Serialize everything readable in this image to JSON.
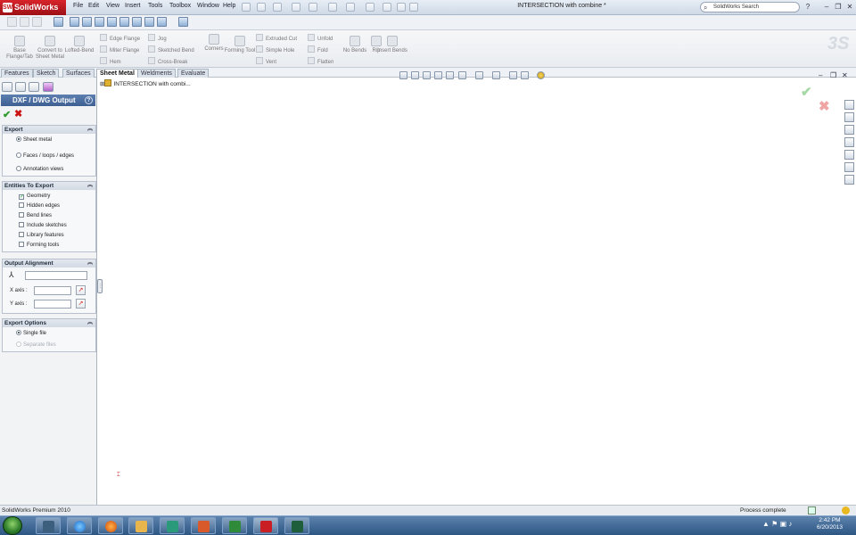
{
  "app": {
    "name": "SolidWorks",
    "document_title": "INTERSECTION with combine *"
  },
  "menu": [
    "File",
    "Edit",
    "View",
    "Insert",
    "Tools",
    "Toolbox",
    "Window",
    "Help"
  ],
  "search": {
    "placeholder": "SolidWorks Search"
  },
  "ribbon": {
    "base_flange": "Base Flange/Tab",
    "convert": "Convert to Sheet Metal",
    "lofted_bend": "Lofted-Bend",
    "edge_flange": "Edge Flange",
    "miter_flange": "Miter Flange",
    "hem": "Hem",
    "jog": "Jog",
    "sketched_bend": "Sketched Bend",
    "cross_break": "Cross-Break",
    "corners": "Corners",
    "forming_tool": "Forming Tool",
    "extruded_cut": "Extruded Cut",
    "simple_hole": "Simple Hole",
    "vent": "Vent",
    "unfold": "Unfold",
    "fold": "Fold",
    "flatten": "Flatten",
    "no_bends": "No Bends",
    "rip": "Rip",
    "insert_bends": "Insert Bends"
  },
  "tabs": [
    "Features",
    "Sketch",
    "Surfaces",
    "Sheet Metal",
    "Weldments",
    "Evaluate"
  ],
  "active_tab": "Sheet Metal",
  "property_manager": {
    "title": "DXF / DWG Output",
    "help": "?",
    "export": {
      "header": "Export",
      "options": [
        {
          "label": "Sheet metal",
          "selected": true
        },
        {
          "label": "Faces / loops / edges",
          "selected": false
        },
        {
          "label": "Annotation views",
          "selected": false
        }
      ]
    },
    "entities": {
      "header": "Entities To Export",
      "items": [
        {
          "label": "Geometry",
          "checked": true
        },
        {
          "label": "Hidden edges",
          "checked": false
        },
        {
          "label": "Bend lines",
          "checked": false
        },
        {
          "label": "Include sketches",
          "checked": false
        },
        {
          "label": "Library features",
          "checked": false
        },
        {
          "label": "Forming tools",
          "checked": false
        }
      ]
    },
    "alignment": {
      "header": "Output Alignment",
      "x_axis_label": "X axis :",
      "y_axis_label": "Y axis :"
    },
    "export_options": {
      "header": "Export Options",
      "single_file": "Single file",
      "separate_files": "Separate files"
    }
  },
  "tree": {
    "root": "INTERSECTION with combi..."
  },
  "status": {
    "left": "SolidWorks Premium 2010",
    "right": "Process complete"
  },
  "clock": {
    "time": "2:42 PM",
    "date": "6/20/2013"
  },
  "colors": {
    "accent": "#d8242b",
    "header_blue": "#4a6c9f",
    "taskbar": "#3a6696"
  }
}
